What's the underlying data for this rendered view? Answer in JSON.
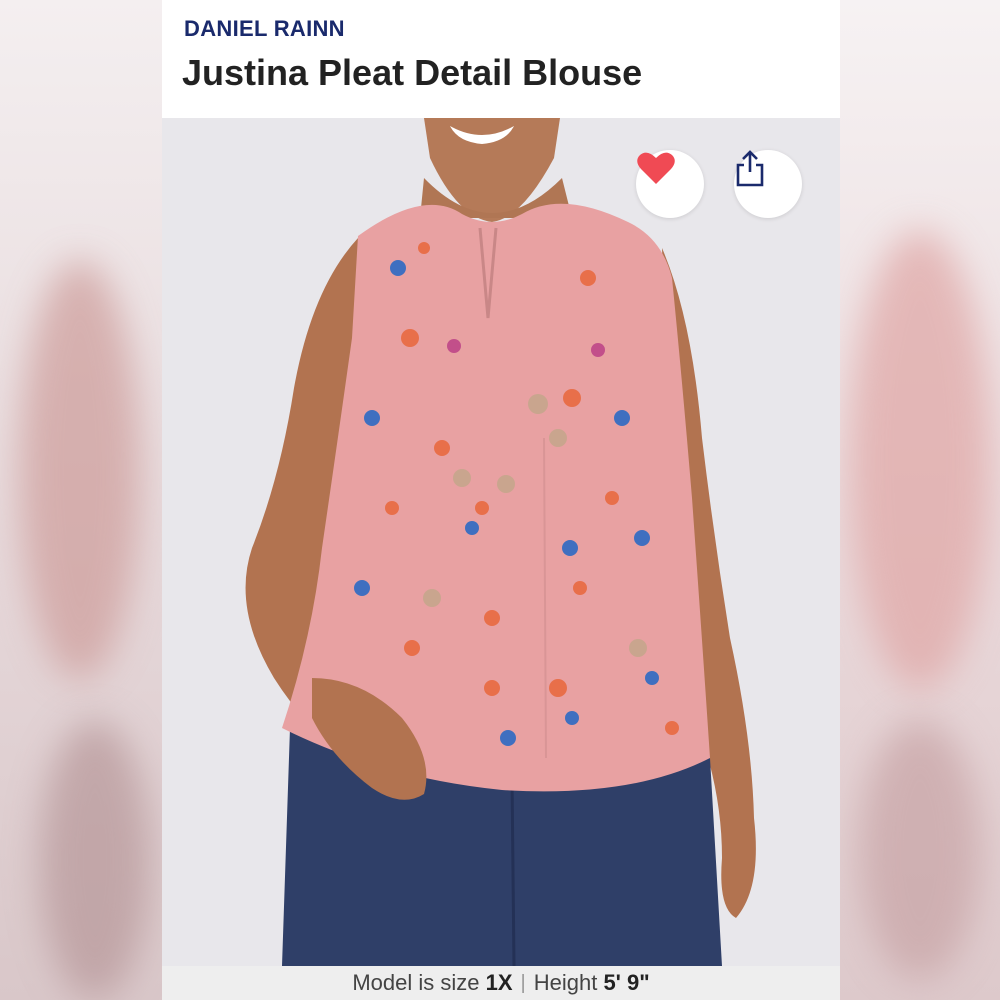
{
  "product": {
    "brand": "DANIEL RAINN",
    "title": "Justina Pleat Detail Blouse"
  },
  "actions": {
    "favorite_icon": "heart-icon",
    "share_icon": "share-icon"
  },
  "caption": {
    "size_prefix": "Model is size ",
    "size_value": "1X",
    "separator": "|",
    "height_prefix": "Height ",
    "height_value": "5' 9\""
  },
  "colors": {
    "brand": "#1a2a6c",
    "heart": "#f04a54",
    "share": "#1a2a6c",
    "blouse": "#e8a1a2"
  }
}
